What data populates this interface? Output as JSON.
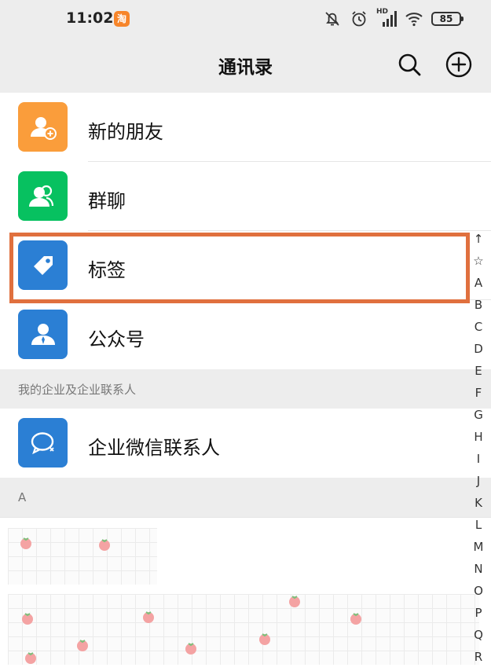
{
  "status_bar": {
    "time": "11:02",
    "app_badge": "淘",
    "network": "HD",
    "battery": "85",
    "icons": [
      "bell-off-icon",
      "alarm-icon",
      "signal-icon",
      "wifi-icon",
      "battery-icon"
    ]
  },
  "header": {
    "title": "通讯录",
    "icons": [
      "search-icon",
      "add-circle-icon"
    ]
  },
  "top_items": [
    {
      "label": "新的朋友",
      "icon": "add-friend-icon",
      "color": "#fa9d3b"
    },
    {
      "label": "群聊",
      "icon": "group-chat-icon",
      "color": "#07c160"
    },
    {
      "label": "标签",
      "icon": "tag-icon",
      "color": "#2b7fd4"
    },
    {
      "label": "公众号",
      "icon": "official-account-icon",
      "color": "#2b7fd4"
    }
  ],
  "enterprise": {
    "section": "我的企业及企业联系人",
    "item": {
      "label": "企业微信联系人",
      "icon": "wecom-icon",
      "color": "#2b7fd4"
    }
  },
  "contacts_section": "A",
  "highlight_color": "#e0703e",
  "alphabet_index": [
    "↑",
    "☆",
    "A",
    "B",
    "C",
    "D",
    "E",
    "F",
    "G",
    "H",
    "I",
    "J",
    "K",
    "L",
    "M",
    "N",
    "O",
    "P",
    "Q",
    "R"
  ]
}
